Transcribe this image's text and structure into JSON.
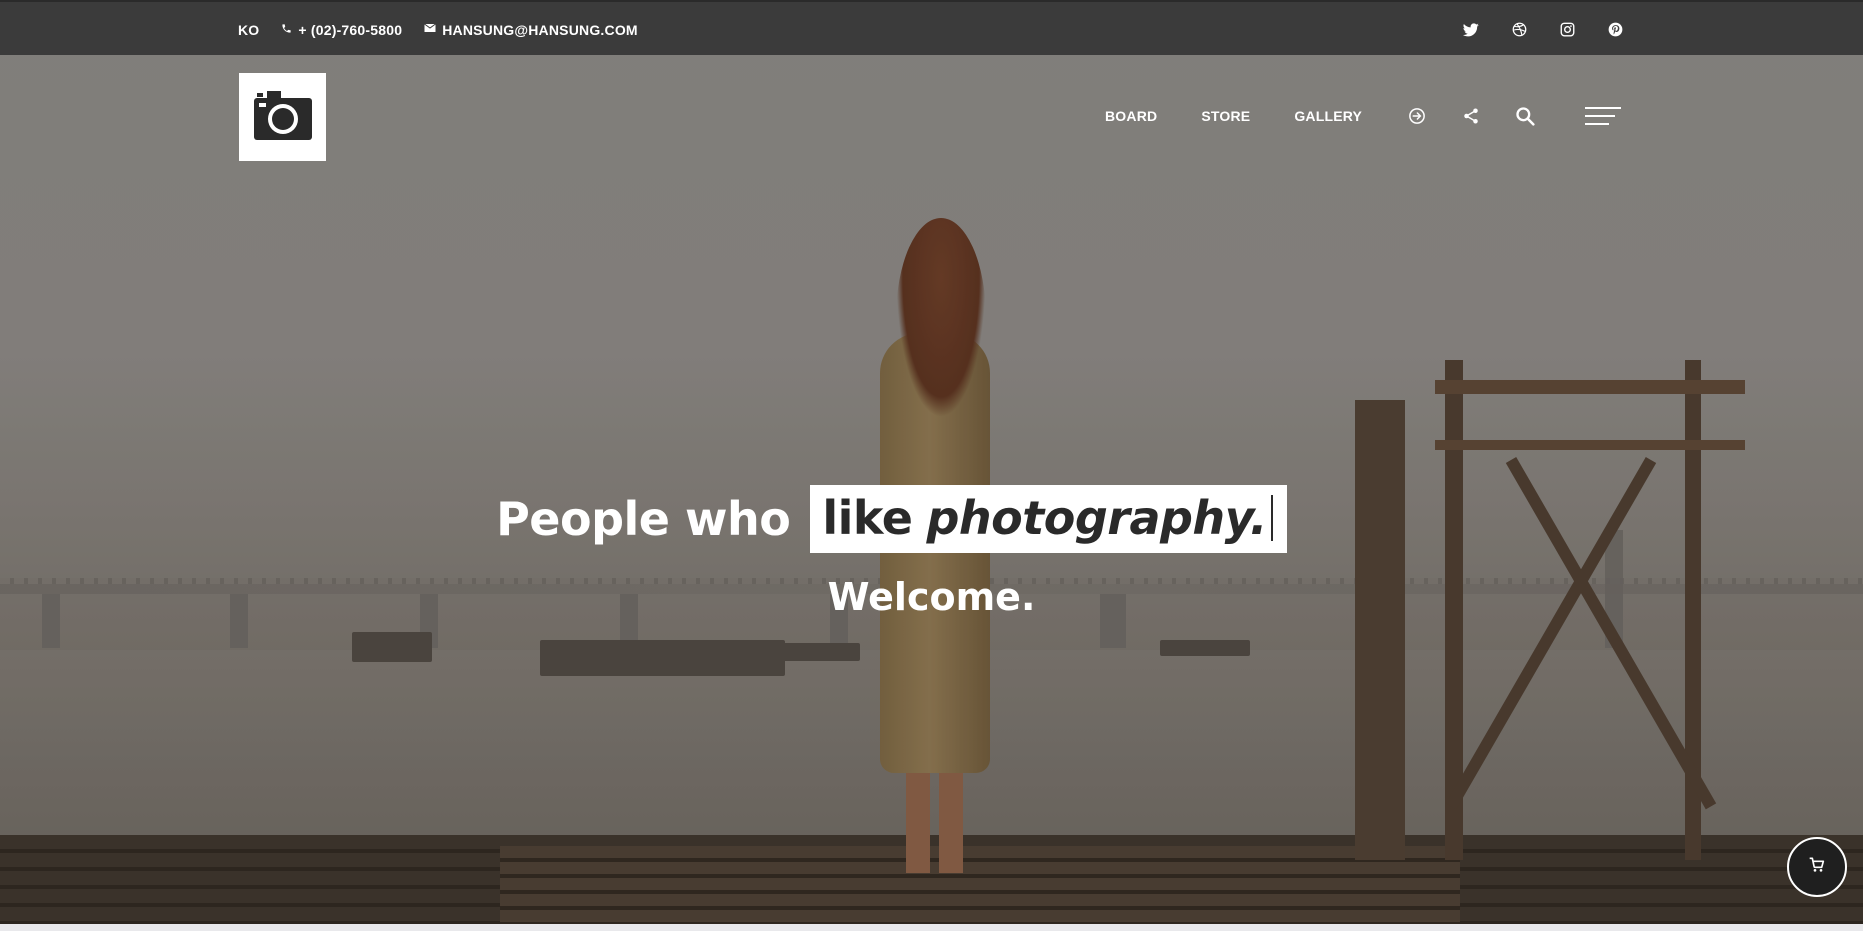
{
  "topbar": {
    "lang": "KO",
    "phone": "+ (02)-760-5800",
    "email": "HANSUNG@HANSUNG.COM",
    "social_icons": [
      "twitter-icon",
      "dribbble-icon",
      "instagram-icon",
      "pinterest-icon"
    ]
  },
  "header": {
    "logo_icon": "camera-icon",
    "nav": [
      "BOARD",
      "STORE",
      "GALLERY"
    ],
    "icons": [
      "login-icon",
      "share-icon",
      "search-icon",
      "menu-icon"
    ]
  },
  "hero": {
    "lead": "People who",
    "highlight_plain": "like",
    "highlight_italic": "photography.",
    "subtitle": "Welcome."
  },
  "cart": {
    "icon": "cart-icon"
  },
  "colors": {
    "topbar_bg": "#3b3b3b",
    "text_light": "#ffffff",
    "text_dark": "#2a2a2a",
    "cart_bg": "#1f1f1f"
  }
}
